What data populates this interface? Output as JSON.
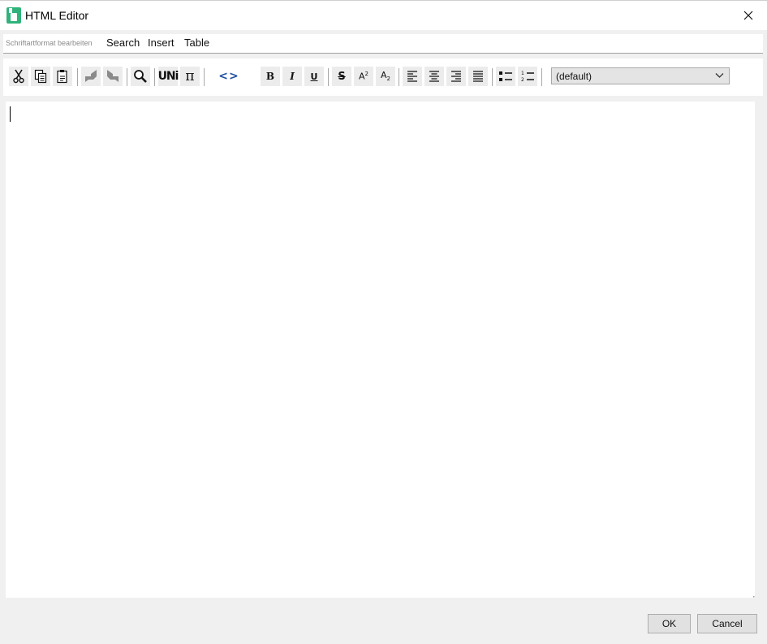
{
  "window": {
    "title": "HTML Editor",
    "app_icon": "app-icon",
    "close_icon": "close-icon"
  },
  "menubar": {
    "hint": "Schriftartformat bearbeiten",
    "items": [
      "Search",
      "Insert",
      "Table"
    ]
  },
  "toolbar": {
    "groups": [
      [
        "cut-icon",
        "copy-icon",
        "paste-icon"
      ],
      [
        "undo-icon",
        "redo-icon"
      ],
      [
        "find-icon"
      ],
      [
        "unicode-icon",
        "pi-icon"
      ],
      [
        "source-code-icon"
      ],
      [
        "bold-icon",
        "italic-icon",
        "underline-icon"
      ],
      [
        "strikethrough-icon",
        "superscript-icon",
        "subscript-icon"
      ],
      [
        "align-left-icon",
        "align-center-icon",
        "align-right-icon",
        "align-justify-icon"
      ],
      [
        "bullet-list-icon",
        "numbered-list-icon"
      ]
    ],
    "glyphs": {
      "unicode": "UNi",
      "pi": "π",
      "source": "<>",
      "bold": "B",
      "italic": "I",
      "underline": "U",
      "strike": "S",
      "superscript_base": "A",
      "superscript_exp": "2",
      "subscript_base": "A",
      "subscript_idx": "2"
    },
    "style_select": {
      "value": "(default)",
      "arrow_icon": "chevron-down-icon"
    }
  },
  "editor": {
    "content": ""
  },
  "buttons": {
    "ok": "OK",
    "cancel": "Cancel"
  },
  "colors": {
    "app_icon": "#2fb37a",
    "source_icon": "#1f4fa0",
    "background": "#f0f0f0"
  }
}
